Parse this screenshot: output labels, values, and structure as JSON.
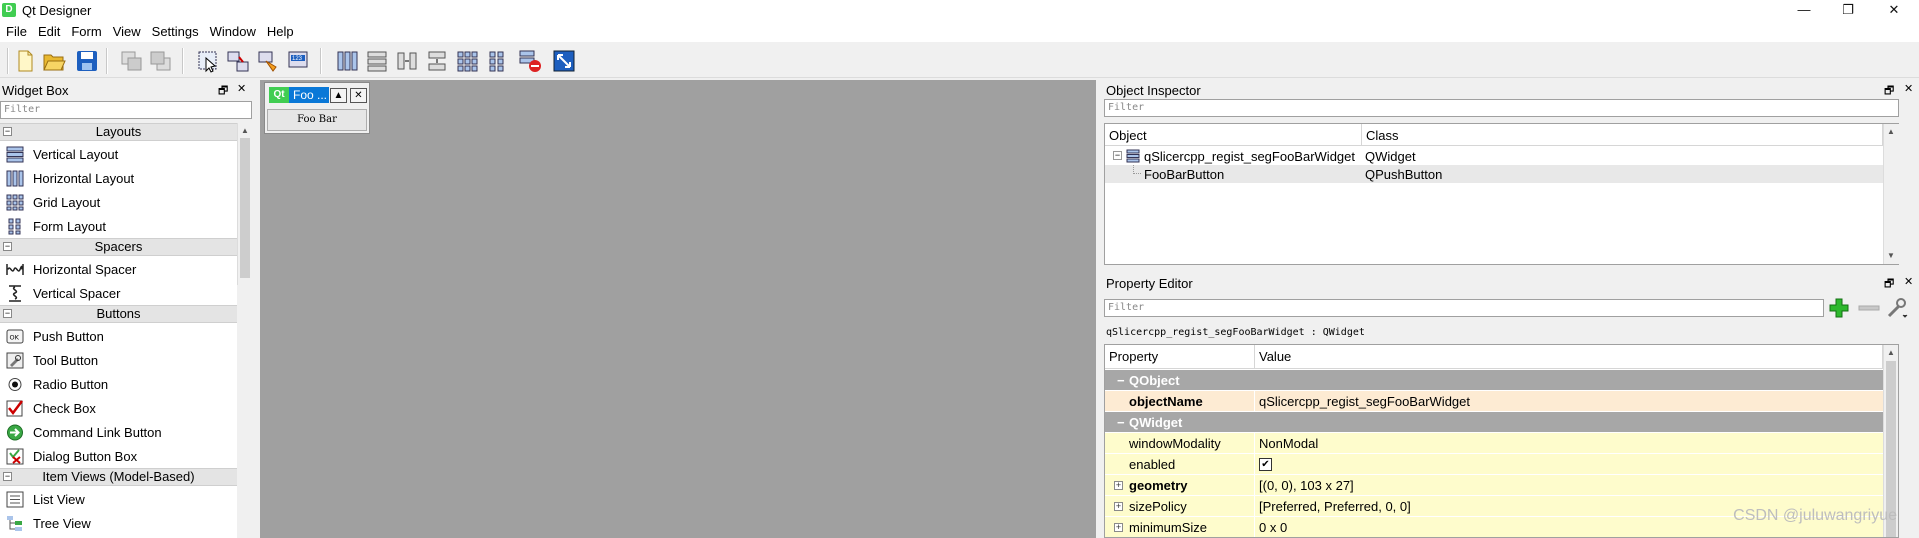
{
  "window": {
    "title": "Qt Designer",
    "app_icon": "D",
    "minimize": "—",
    "maximize": "❐",
    "close": "✕"
  },
  "menu": [
    "File",
    "Edit",
    "Form",
    "View",
    "Settings",
    "Window",
    "Help"
  ],
  "widget_box": {
    "title": "Widget Box",
    "filter_placeholder": "Filter",
    "categories": {
      "layouts": "Layouts",
      "spacers": "Spacers",
      "buttons": "Buttons",
      "item_views": "Item Views (Model-Based)"
    },
    "layouts": [
      "Vertical Layout",
      "Horizontal Layout",
      "Grid Layout",
      "Form Layout"
    ],
    "spacers": [
      "Horizontal Spacer",
      "Vertical Spacer"
    ],
    "buttons": [
      "Push Button",
      "Tool Button",
      "Radio Button",
      "Check Box",
      "Command Link Button",
      "Dialog Button Box"
    ],
    "item_views": [
      "List View",
      "Tree View"
    ]
  },
  "form_window": {
    "icon_text": "Qt",
    "caption": "Foo ...",
    "button_text": "Foo Bar"
  },
  "object_inspector": {
    "title": "Object Inspector",
    "filter_placeholder": "Filter",
    "columns": [
      "Object",
      "Class"
    ],
    "rows": [
      {
        "object": "qSlicercpp_regist_segFooBarWidget",
        "class": "QWidget"
      },
      {
        "object": "FooBarButton",
        "class": "QPushButton"
      }
    ]
  },
  "property_editor": {
    "title": "Property Editor",
    "filter_placeholder": "Filter",
    "context": "qSlicercpp_regist_segFooBarWidget : QWidget",
    "columns": [
      "Property",
      "Value"
    ],
    "groups": [
      "QObject",
      "QWidget"
    ],
    "rows": [
      {
        "name": "objectName",
        "value": "qSlicercpp_regist_segFooBarWidget"
      },
      {
        "name": "windowModality",
        "value": "NonModal"
      },
      {
        "name": "enabled",
        "value": "✔"
      },
      {
        "name": "geometry",
        "value": "[(0, 0), 103 x 27]"
      },
      {
        "name": "sizePolicy",
        "value": "[Preferred, Preferred, 0, 0]"
      },
      {
        "name": "minimumSize",
        "value": "0 x 0"
      }
    ]
  },
  "watermark": "CSDN @juluwangriyue",
  "colors": {
    "accent": "#0a78d7",
    "qt_green": "#41cd52",
    "property_yellow": "#fefccc",
    "property_selected": "#fdebd3",
    "group_gray": "#a7a7a7"
  }
}
